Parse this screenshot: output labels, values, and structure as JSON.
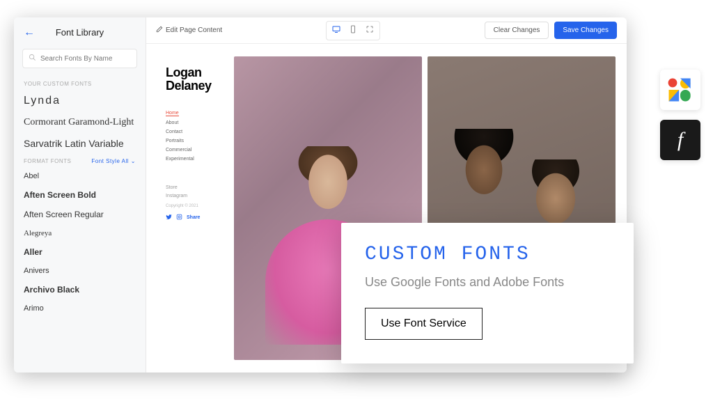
{
  "sidebar": {
    "title": "Font Library",
    "search_placeholder": "Search Fonts By Name",
    "section_custom": "YOUR CUSTOM FONTS",
    "section_format": "FORMAT FONTS",
    "filter_label": "Font Style",
    "filter_value": "All",
    "custom_fonts": [
      "Lynda",
      "Cormorant Garamond-Light",
      "Sarvatrik Latin Variable"
    ],
    "format_fonts": [
      "Abel",
      "Aften Screen Bold",
      "Aften Screen Regular",
      "Alegreya",
      "Aller",
      "Anivers",
      "Archivo Black",
      "Arimo"
    ]
  },
  "toolbar": {
    "edit_label": "Edit Page Content",
    "clear_label": "Clear Changes",
    "save_label": "Save Changes"
  },
  "site": {
    "title_line1": "Logan",
    "title_line2": "Delaney",
    "nav": {
      "home": "Home",
      "about": "About",
      "contact": "Contact",
      "portraits": "Portraits",
      "commercial": "Commercial",
      "experimental": "Experimental"
    },
    "secondary": {
      "store": "Store",
      "instagram": "Instagram"
    },
    "copyright": "Copyright © 2021",
    "share_label": "Share"
  },
  "promo": {
    "title": "CUSTOM FONTS",
    "subtitle": "Use Google Fonts and Adobe Fonts",
    "button_label": "Use Font Service"
  },
  "badges": {
    "adobe_glyph": "f"
  }
}
